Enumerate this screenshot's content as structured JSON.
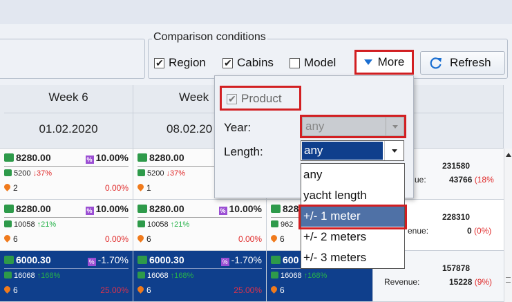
{
  "conditions": {
    "legend": "Comparison conditions",
    "checkboxes": [
      {
        "label": "Region",
        "checked": true
      },
      {
        "label": "Cabins",
        "checked": true
      },
      {
        "label": "Model",
        "checked": false
      }
    ],
    "more_label": "More",
    "refresh_label": "Refresh"
  },
  "columns": [
    {
      "week": "Week 6",
      "date": "01.02.2020"
    },
    {
      "week": "Week",
      "date": "08.02.20"
    }
  ],
  "rows": [
    {
      "cells": [
        {
          "price": "8280.00",
          "pct": "10.00%",
          "count": "5200",
          "trend": "↓37%",
          "trend_dir": "down",
          "region": "2",
          "rpct": "0.00%"
        },
        {
          "price": "8280.00",
          "pct": "",
          "count": "5200",
          "trend": "↓37%",
          "trend_dir": "down",
          "region": "1",
          "rpct": ""
        }
      ],
      "side": {
        "num1": "231580",
        "revenue_label": "ue:",
        "num2": "43766",
        "num2_pct": "(18%"
      }
    },
    {
      "cells": [
        {
          "price": "8280.00",
          "pct": "10.00%",
          "count": "10058",
          "trend": "↑21%",
          "trend_dir": "up",
          "region": "6",
          "rpct": "0.00%"
        },
        {
          "price": "8280.00",
          "pct": "10.00%",
          "count": "10058",
          "trend": "↑21%",
          "trend_dir": "up",
          "region": "6",
          "rpct": "0.00%"
        },
        {
          "price": "828",
          "pct": "",
          "count": "962",
          "trend": "",
          "trend_dir": "up",
          "region": "6",
          "rpct": ""
        }
      ],
      "side": {
        "num1": "228310",
        "revenue_label": "enue:",
        "num2": "0",
        "num2_pct": "(0%)"
      }
    },
    {
      "cells": [
        {
          "price": "6000.30",
          "pct": "-1.70%",
          "count": "16068",
          "trend": "↑168%",
          "trend_dir": "up",
          "region": "6",
          "rpct": "25.00%"
        },
        {
          "price": "6000.30",
          "pct": "-1.70%",
          "count": "16068",
          "trend": "↑168%",
          "trend_dir": "up",
          "region": "6",
          "rpct": "25.00%"
        },
        {
          "price": "600",
          "pct": "",
          "count": "16068",
          "trend": "↑168%",
          "trend_dir": "up",
          "region": "6",
          "rpct": ""
        }
      ],
      "side": {
        "num1": "157878",
        "revenue_label": "Revenue:",
        "num2": "15228",
        "num2_pct": "(9%)"
      }
    }
  ],
  "popup": {
    "product_label": "Product",
    "product_checked": true,
    "year_label": "Year:",
    "year_value": "any",
    "length_label": "Length:",
    "length_value": "any",
    "length_options": [
      "any",
      "yacht length",
      "+/- 1 meter",
      "+/- 2 meters",
      "+/- 3 meters"
    ],
    "highlighted_option": "+/- 1 meter"
  },
  "colors": {
    "accent_red": "#d21f22",
    "selected_blue": "#0f3f8c",
    "highlight_blue": "#4f71a6"
  }
}
